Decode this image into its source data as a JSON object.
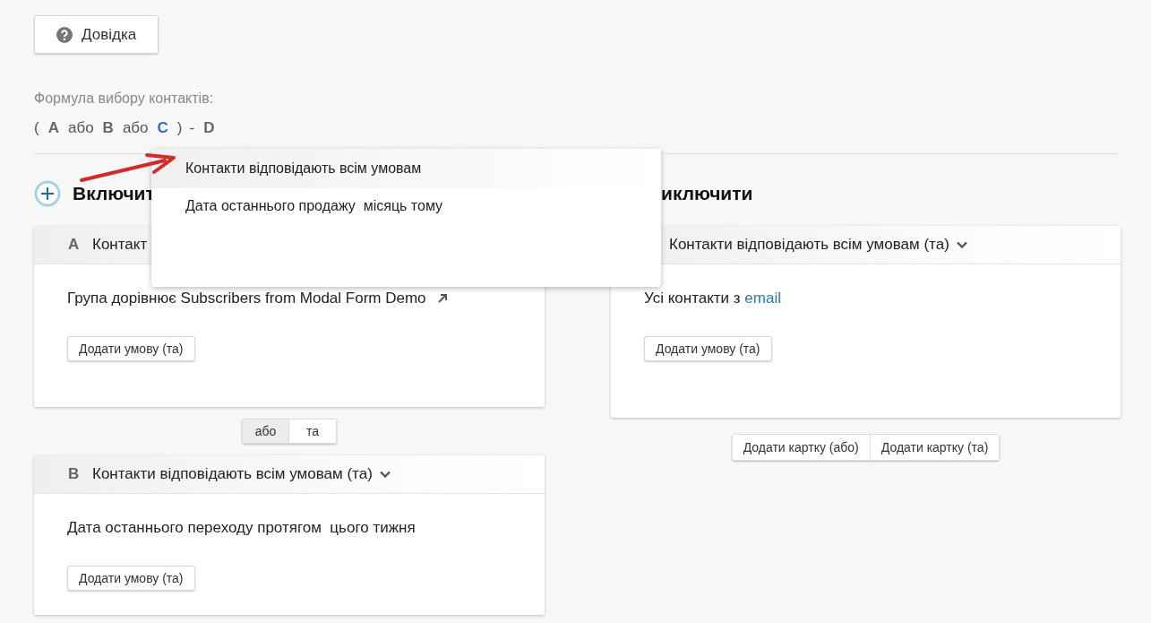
{
  "help_button": {
    "label": "Довідка"
  },
  "formula": {
    "label": "Формула вибору контактів:",
    "tokens": [
      {
        "kind": "symbol",
        "text": "("
      },
      {
        "kind": "letter",
        "text": "A",
        "selected": false
      },
      {
        "kind": "word",
        "text": "або"
      },
      {
        "kind": "letter",
        "text": "B",
        "selected": false
      },
      {
        "kind": "word",
        "text": "або"
      },
      {
        "kind": "letter",
        "text": "C",
        "selected": true
      },
      {
        "kind": "symbol",
        "text": ")"
      },
      {
        "kind": "symbol",
        "text": "-"
      },
      {
        "kind": "letter",
        "text": "D",
        "selected": false
      }
    ]
  },
  "include": {
    "heading": "Включит",
    "items": [
      {
        "kind": "card",
        "letter": "A",
        "title": "Контакт",
        "conditions": [
          {
            "text": "Група дорівнює Subscribers from Modal Form Demo",
            "external": true
          }
        ],
        "add_button": "Додати умову (та)"
      },
      {
        "kind": "joiner",
        "options": [
          {
            "label": "або",
            "selected": true
          },
          {
            "label": "та",
            "selected": false
          }
        ]
      },
      {
        "kind": "card",
        "letter": "B",
        "title": "Контакти відповідають всім умовам (та)",
        "caret": true,
        "conditions": [
          {
            "text": "Дата останнього переходу протягом  цього тижня"
          }
        ],
        "add_button": "Додати умову (та)"
      }
    ]
  },
  "exclude": {
    "heading": "иключити",
    "items": [
      {
        "kind": "card",
        "title": "Контакти відповідають всім умовам (та)",
        "caret": true,
        "conditions": [
          {
            "text": "Усі контакти з",
            "link": "email"
          }
        ],
        "add_button": "Додати умову (та)"
      }
    ],
    "add_card_buttons": [
      "Додати картку (або)",
      "Додати картку (та)"
    ]
  },
  "dropdown": {
    "items": [
      {
        "label": "Контакти відповідають всім умовам",
        "selected": true
      },
      {
        "label": "Дата останнього продажу  місяць тому",
        "selected": false
      }
    ]
  }
}
